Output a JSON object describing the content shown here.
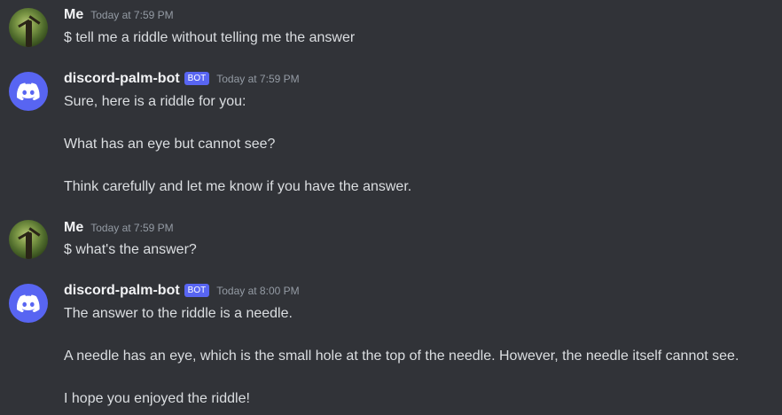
{
  "messages": [
    {
      "author": "Me",
      "is_bot": false,
      "timestamp": "Today at 7:59 PM",
      "avatar": "tree-photo-avatar",
      "lines": [
        "$ tell me a riddle without telling me the answer"
      ]
    },
    {
      "author": "discord-palm-bot",
      "is_bot": true,
      "bot_tag": "BOT",
      "timestamp": "Today at 7:59 PM",
      "avatar": "discord-logo-icon",
      "lines": [
        "Sure, here is a riddle for you:",
        "What has an eye but cannot see?",
        "Think carefully and let me know if you have the answer."
      ]
    },
    {
      "author": "Me",
      "is_bot": false,
      "timestamp": "Today at 7:59 PM",
      "avatar": "tree-photo-avatar",
      "lines": [
        "$ what's the answer?"
      ]
    },
    {
      "author": "discord-palm-bot",
      "is_bot": true,
      "bot_tag": "BOT",
      "timestamp": "Today at 8:00 PM",
      "avatar": "discord-logo-icon",
      "lines": [
        "The answer to the riddle is a needle.",
        "A needle has an eye, which is the small hole at the top of the needle. However, the needle itself cannot see.",
        "I hope you enjoyed the riddle!"
      ]
    }
  ],
  "colors": {
    "background": "#313338",
    "text": "#dbdee1",
    "username": "#f2f3f5",
    "timestamp": "#949ba4",
    "bot_accent": "#5865f2"
  }
}
